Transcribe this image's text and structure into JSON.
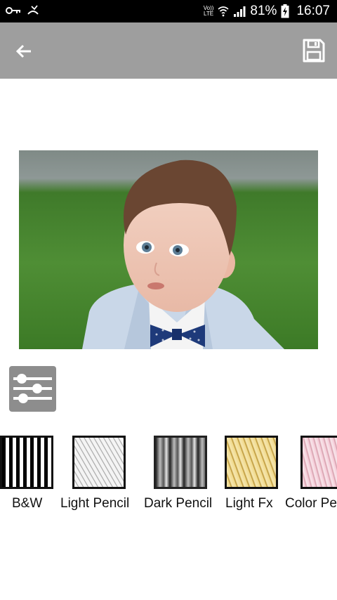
{
  "status_bar": {
    "volte_line1": "Vo))",
    "volte_line2": "LTE",
    "battery_percent": "81%",
    "time": "16:07"
  },
  "toolbar": {
    "back_icon": "arrow-back-icon",
    "save_icon": "floppy-disk-icon"
  },
  "editor": {
    "adjust_icon": "sliders-icon"
  },
  "filters": [
    {
      "label": "B&W"
    },
    {
      "label": "Light Pencil"
    },
    {
      "label": "Dark Pencil"
    },
    {
      "label": "Light Fx"
    },
    {
      "label": "Color Pencil"
    }
  ],
  "colors": {
    "toolbar": "#9e9e9e",
    "adjust_button": "#8d8d8d",
    "status_bar": "#000000"
  }
}
